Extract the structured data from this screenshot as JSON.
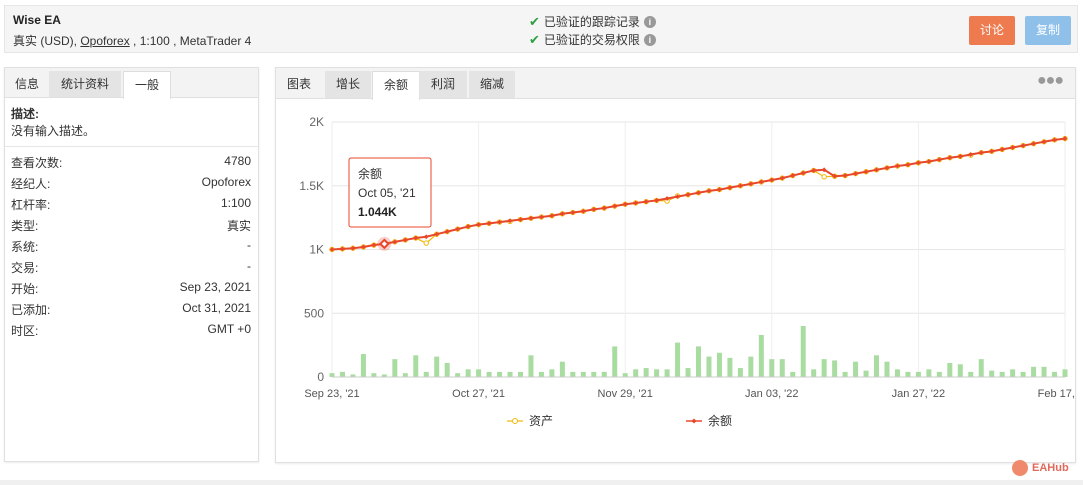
{
  "account": {
    "name": "Wise EA",
    "type_currency": "真实 (USD),",
    "broker": "Opoforex",
    "details": ", 1:100 , MetaTrader 4"
  },
  "verify": {
    "track_record": "已验证的跟踪记录",
    "trading_privileges": "已验证的交易权限"
  },
  "buttons": {
    "discuss": "讨论",
    "copy": "复制"
  },
  "left_tabs": [
    "信息",
    "统计资料",
    "一般"
  ],
  "description": {
    "label": "描述:",
    "text": "没有输入描述。"
  },
  "info_rows": [
    {
      "k": "查看次数:",
      "v": "4780"
    },
    {
      "k": "经纪人:",
      "v": "Opoforex"
    },
    {
      "k": "杠杆率:",
      "v": "1:100"
    },
    {
      "k": "类型:",
      "v": "真实"
    },
    {
      "k": "系统:",
      "v": "-"
    },
    {
      "k": "交易:",
      "v": "-"
    },
    {
      "k": "开始:",
      "v": "Sep 23, 2021"
    },
    {
      "k": "已添加:",
      "v": "Oct 31, 2021"
    },
    {
      "k": "时区:",
      "v": "GMT +0"
    }
  ],
  "chart_tabs": [
    "图表",
    "增长",
    "余额",
    "利润",
    "缩减"
  ],
  "menu_icon": "ellipsis-icon",
  "tooltip": {
    "title": "余额",
    "date": "Oct 05, '21",
    "value": "1.044K"
  },
  "watermark": "EAHub",
  "colors": {
    "balance": "#e8472b",
    "equity": "#f2b705",
    "bars": "#a8dca0",
    "discuss": "#ee7b50",
    "copy": "#8fc0ea",
    "check": "#2ea043"
  },
  "chart_data": {
    "type": "line",
    "x_start": "Sep 23, '21",
    "x_end": "Feb 17, '22",
    "x_tick_labels": [
      "Sep 23, '21",
      "Oct 27, '21",
      "Nov 29, '21",
      "Jan 03, '22",
      "Jan 27, '22",
      "Feb 17, '22"
    ],
    "y_tick_labels": [
      "0",
      "500",
      "1K",
      "1.5K",
      "2K"
    ],
    "ylim": [
      0,
      2000
    ],
    "legend": [
      "资产",
      "余额"
    ],
    "legend_position": "bottom",
    "grid": true,
    "series": [
      {
        "name": "余额",
        "values": [
          1000,
          1005,
          1010,
          1020,
          1035,
          1044,
          1060,
          1075,
          1090,
          1100,
          1120,
          1140,
          1160,
          1180,
          1195,
          1205,
          1215,
          1225,
          1235,
          1245,
          1255,
          1265,
          1280,
          1290,
          1300,
          1315,
          1325,
          1340,
          1355,
          1365,
          1375,
          1385,
          1400,
          1415,
          1430,
          1445,
          1460,
          1470,
          1485,
          1500,
          1515,
          1530,
          1545,
          1560,
          1580,
          1600,
          1620,
          1625,
          1575,
          1580,
          1595,
          1610,
          1625,
          1640,
          1655,
          1665,
          1680,
          1690,
          1705,
          1720,
          1730,
          1745,
          1760,
          1770,
          1785,
          1800,
          1815,
          1830,
          1845,
          1860,
          1870
        ]
      },
      {
        "name": "资产",
        "values": [
          1000,
          1005,
          1010,
          1020,
          1035,
          1044,
          1060,
          1075,
          1090,
          1050,
          1120,
          1140,
          1160,
          1180,
          1195,
          1205,
          1215,
          1220,
          1235,
          1245,
          1255,
          1265,
          1280,
          1290,
          1300,
          1315,
          1325,
          1340,
          1355,
          1365,
          1375,
          1385,
          1380,
          1420,
          1430,
          1445,
          1460,
          1470,
          1485,
          1500,
          1515,
          1530,
          1545,
          1560,
          1580,
          1600,
          1620,
          1570,
          1575,
          1580,
          1595,
          1610,
          1625,
          1640,
          1655,
          1665,
          1680,
          1690,
          1705,
          1720,
          1730,
          1740,
          1760,
          1770,
          1785,
          1800,
          1815,
          1830,
          1845,
          1860,
          1870
        ]
      }
    ],
    "bar_series": {
      "values": [
        30,
        40,
        20,
        180,
        30,
        20,
        140,
        30,
        170,
        40,
        160,
        110,
        30,
        60,
        60,
        40,
        40,
        40,
        40,
        170,
        40,
        60,
        120,
        40,
        40,
        40,
        40,
        240,
        30,
        60,
        70,
        60,
        60,
        270,
        70,
        240,
        160,
        190,
        150,
        70,
        160,
        330,
        140,
        140,
        40,
        400,
        60,
        140,
        130,
        40,
        120,
        50,
        170,
        120,
        60,
        40,
        40,
        60,
        40,
        110,
        100,
        40,
        140,
        50,
        40,
        60,
        40,
        80,
        80,
        40,
        60
      ]
    }
  }
}
